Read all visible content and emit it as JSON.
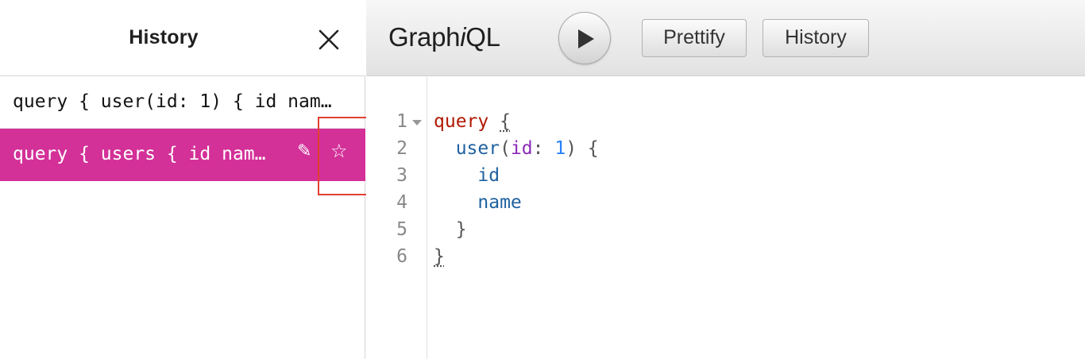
{
  "history_panel": {
    "title": "History",
    "close_icon": "close-icon",
    "items": [
      {
        "label": "query { user(id: 1) { id name } }",
        "display": "query { user(id: 1) { id nam…",
        "active": false
      },
      {
        "label": "query { users { id name } }",
        "display": "query { users { id nam…",
        "active": true,
        "edit_icon": "✎",
        "favorite_icon": "☆"
      }
    ],
    "active_color": "#d33098",
    "annotation_color": "#e2402f"
  },
  "topbar": {
    "title_prefix": "Graph",
    "title_italic": "i",
    "title_suffix": "QL",
    "execute_icon": "play-icon",
    "prettify_label": "Prettify",
    "history_label": "History"
  },
  "editor": {
    "line_numbers": [
      "1",
      "2",
      "3",
      "4",
      "5",
      "6"
    ],
    "tokens": {
      "l1_kw": "query",
      "l1_brace": "{",
      "l2_field": "user",
      "l2_open": "(",
      "l2_arg": "id",
      "l2_colon": ": ",
      "l2_num": "1",
      "l2_close": ") {",
      "l3_field": "id",
      "l4_field": "name",
      "l5_brace": "}",
      "l6_brace": "}"
    },
    "colors": {
      "keyword": "#b11a04",
      "field": "#1f61a0",
      "argument": "#8b2bb9",
      "number": "#2882f9"
    }
  }
}
